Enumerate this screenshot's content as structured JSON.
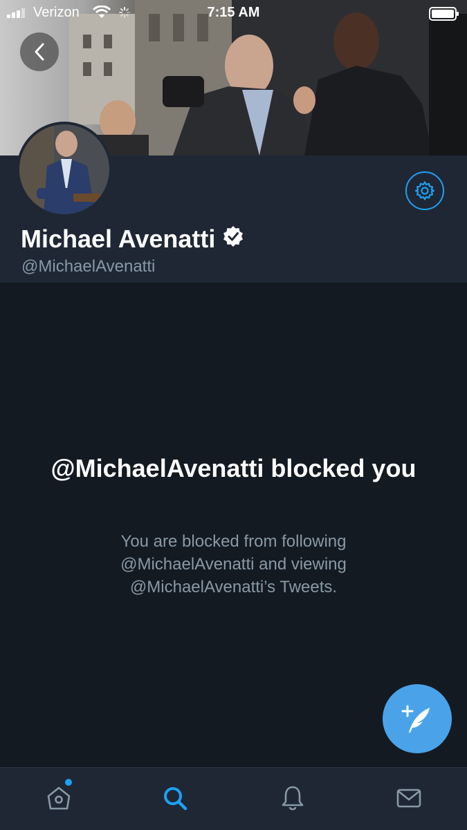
{
  "status_bar": {
    "carrier": "Verizon",
    "time": "7:15 AM"
  },
  "profile": {
    "display_name": "Michael Avenatti",
    "handle": "@MichaelAvenatti",
    "verified": true
  },
  "blocked": {
    "title": "@MichaelAvenatti blocked you",
    "message": "You are blocked from following @MichaelAvenatti and viewing @MichaelAvenatti’s Tweets."
  },
  "icons": {
    "back": "chevron-left-icon",
    "settings": "gear-icon",
    "compose": "compose-tweet-icon",
    "home": "home-icon",
    "search": "search-icon",
    "notifications": "bell-icon",
    "messages": "envelope-icon"
  },
  "colors": {
    "accent": "#1da1f2",
    "background": "#141a22",
    "header_panel": "#1f2735",
    "secondary_text": "#8899a6"
  },
  "tabs": {
    "active": "search",
    "home_has_notification": true
  }
}
